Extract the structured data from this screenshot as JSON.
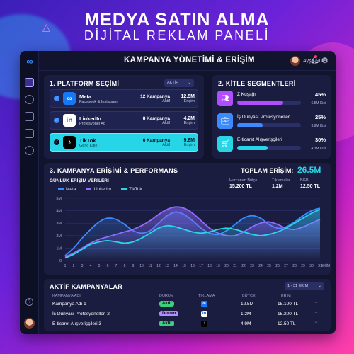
{
  "hero": {
    "title": "MEDYA SATIN ALMA",
    "subtitle": "DİJİTAL REKLAM PANELİ"
  },
  "topbar": {
    "title": "KAMPANYA YÖNETİMİ & ERİŞİM",
    "user_name": "Ayşe Gül",
    "icons": [
      "bell-icon",
      "gear-icon"
    ]
  },
  "sidebar": {
    "icons": [
      "dashboard-icon",
      "users-icon",
      "megaphone-icon",
      "calendar-icon",
      "settings-icon",
      "help-icon"
    ]
  },
  "platforms": {
    "title": "1. PLATFORM SEÇİMİ",
    "filter": "AKTİF",
    "items": [
      {
        "name": "Meta",
        "sub": "Facebook & Instagram",
        "count": "12 Kampanya",
        "status": "Aktif",
        "reach": "12.5M",
        "reach_label": "Erişim",
        "icon": "meta-icon",
        "color": "#1877f2"
      },
      {
        "name": "LinkedIn",
        "sub": "Profesyonel Ağ",
        "count": "8 Kampanya",
        "status": "Aktif",
        "reach": "4.2M",
        "reach_label": "Erişim",
        "icon": "linkedin-icon",
        "color": "#0a66c2"
      },
      {
        "name": "TikTok",
        "sub": "Genç Kitle",
        "count": "6 Kampanya",
        "status": "Aktif",
        "reach": "9.8M",
        "reach_label": "Erişim",
        "icon": "tiktok-icon",
        "color": "#000000"
      }
    ]
  },
  "segments": {
    "title": "2. KİTLE SEGMENTLERİ",
    "items": [
      {
        "name": "Z Kuşağı",
        "pct": "45%",
        "fill": 0.45,
        "people": "6.5M Kişi",
        "color": "#b14cff",
        "icon": "people-icon"
      },
      {
        "name": "İş Dünyası Profesyonelleri",
        "pct": "25%",
        "fill": 0.25,
        "people": "3.8M Kişi",
        "color": "#3b8bff",
        "icon": "briefcase-icon"
      },
      {
        "name": "E-ticaret Alışverişçileri",
        "pct": "30%",
        "fill": 0.3,
        "people": "4.3M Kişi",
        "color": "#27d6e6",
        "icon": "cart-icon"
      }
    ]
  },
  "performance": {
    "title": "3. KAMPANYA ERİŞİMİ & PERFORMANS",
    "total_label": "TOPLAM ERİŞİM:",
    "total_value": "26.5M",
    "daily_label": "GÜNLÜK ERİŞİM VERİLERİ",
    "stats": [
      {
        "label": "Harcanan Bütçe",
        "value": "15.200 TL"
      },
      {
        "label": "Tıklamalar",
        "value": "1.2M"
      },
      {
        "label": "BGB",
        "value": "12.50 TL"
      }
    ]
  },
  "chart_data": {
    "type": "line",
    "x": [
      "1",
      "2",
      "3",
      "4",
      "5",
      "6",
      "7",
      "8",
      "9",
      "10",
      "11",
      "12",
      "13",
      "14",
      "15",
      "16",
      "17",
      "18",
      "19",
      "20",
      "21",
      "22",
      "23",
      "24",
      "25",
      "26",
      "27",
      "28",
      "29",
      "30",
      "31"
    ],
    "x_end_label": "EKİM",
    "ylim": [
      0,
      5
    ],
    "yticks": [
      "0",
      "1M",
      "2M",
      "3M",
      "4M",
      "5M"
    ],
    "grid": true,
    "legend_position": "top-left",
    "series": [
      {
        "name": "Meta",
        "color": "#3b8bff",
        "values": [
          0.4,
          1.0,
          1.8,
          2.5,
          3.1,
          3.4,
          3.3,
          2.9,
          2.4,
          2.2,
          2.4,
          3.0,
          3.6,
          3.9,
          3.7,
          3.2,
          2.6,
          2.2,
          2.1,
          2.4,
          2.9,
          3.4,
          3.6,
          3.4,
          2.9,
          2.6,
          2.7,
          3.1,
          3.6,
          4.0,
          4.2
        ]
      },
      {
        "name": "LinkedIn",
        "color": "#8f6bff",
        "values": [
          0.3,
          0.6,
          1.0,
          1.4,
          1.7,
          1.9,
          2.1,
          2.3,
          2.5,
          2.8,
          3.2,
          3.7,
          4.1,
          4.3,
          4.2,
          3.8,
          3.2,
          2.6,
          2.2,
          2.0,
          2.0,
          2.3,
          2.7,
          3.0,
          3.1,
          2.9,
          2.6,
          2.5,
          2.7,
          3.0,
          3.3
        ]
      },
      {
        "name": "TikTok",
        "color": "#27d6e6",
        "values": [
          0.2,
          0.5,
          0.9,
          1.3,
          1.5,
          1.6,
          1.5,
          1.4,
          1.5,
          1.8,
          2.2,
          2.6,
          2.8,
          2.7,
          2.5,
          2.3,
          2.2,
          2.3,
          2.5,
          2.6,
          2.5,
          2.3,
          2.1,
          2.0,
          2.1,
          2.3,
          2.6,
          3.0,
          3.4,
          3.8,
          4.1
        ]
      }
    ]
  },
  "campaigns": {
    "title": "AKTİF KAMPANYALAR",
    "range": "1 - 31 EKİM",
    "headers": [
      "KAMPANYA ADI",
      "DURUM",
      "TIKLAMA",
      "BÜTÇE",
      "ERİM"
    ],
    "rows": [
      {
        "name": "Kampanya Adı 1",
        "status": "Aktif",
        "status_color": "#3ad17a",
        "icon": "meta-icon",
        "clicks": "12.5M",
        "budget": "15.100 TL"
      },
      {
        "name": "İş Dünyası Profesyonelleri 2",
        "status": "Durum",
        "status_color": "#b38bff",
        "icon": "linkedin-icon",
        "clicks": "1.2M",
        "budget": "15.200 TL"
      },
      {
        "name": "E-ticaret Alışverişçileri 3",
        "status": "Aktif",
        "status_color": "#3ad17a",
        "icon": "tiktok-icon",
        "clicks": "4.9M",
        "budget": "12.50 TL"
      }
    ]
  }
}
